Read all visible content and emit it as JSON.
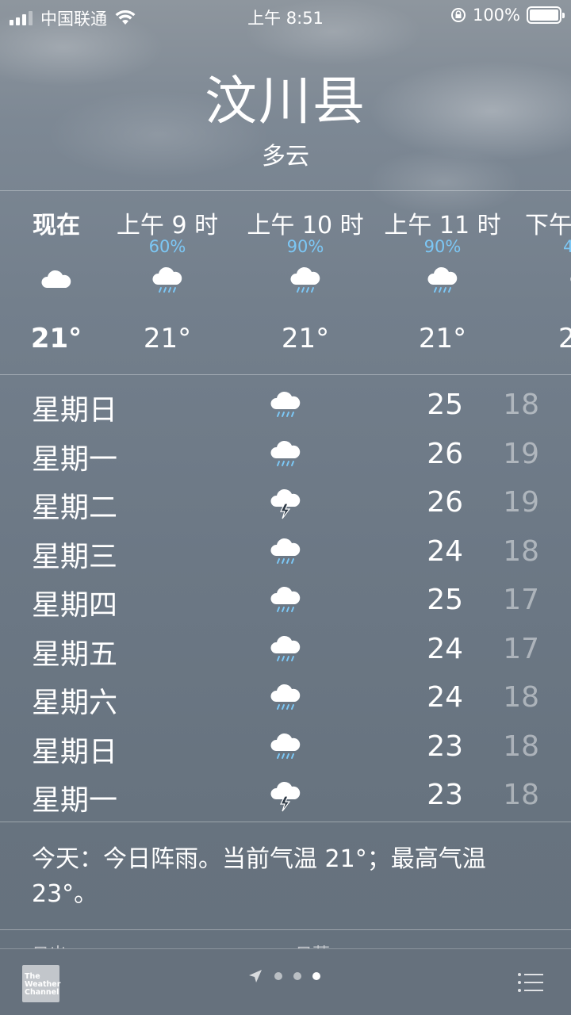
{
  "status_bar": {
    "carrier": "中国联通",
    "time": "上午 8:51",
    "battery": "100%"
  },
  "location": {
    "city": "汶川县",
    "condition": "多云"
  },
  "hourly": [
    {
      "label": "现在",
      "pop": "",
      "icon": "cloud-icon",
      "temp": "21°"
    },
    {
      "label": "上午 9 时",
      "pop": "60%",
      "icon": "rain-cloud-icon",
      "temp": "21°"
    },
    {
      "label": "上午 10 时",
      "pop": "90%",
      "icon": "rain-cloud-icon",
      "temp": "21°"
    },
    {
      "label": "上午 11 时",
      "pop": "90%",
      "icon": "rain-cloud-icon",
      "temp": "21°"
    },
    {
      "label": "下午",
      "pop": "4",
      "icon": "rain-cloud-icon",
      "temp": "2"
    }
  ],
  "daily": [
    {
      "day": "星期日",
      "icon": "rain-cloud-icon",
      "high": "25",
      "low": "18"
    },
    {
      "day": "星期一",
      "icon": "rain-cloud-icon",
      "high": "26",
      "low": "19"
    },
    {
      "day": "星期二",
      "icon": "thunderstorm-icon",
      "high": "26",
      "low": "19"
    },
    {
      "day": "星期三",
      "icon": "rain-cloud-icon",
      "high": "24",
      "low": "18"
    },
    {
      "day": "星期四",
      "icon": "rain-cloud-icon",
      "high": "25",
      "low": "17"
    },
    {
      "day": "星期五",
      "icon": "rain-cloud-icon",
      "high": "24",
      "low": "17"
    },
    {
      "day": "星期六",
      "icon": "rain-cloud-icon",
      "high": "24",
      "low": "18"
    },
    {
      "day": "星期日",
      "icon": "rain-cloud-icon",
      "high": "23",
      "low": "18"
    },
    {
      "day": "星期一",
      "icon": "thunderstorm-icon",
      "high": "23",
      "low": "18"
    }
  ],
  "summary": "今天：今日阵雨。当前气温 21°；最高气温 23°。",
  "details_partial": {
    "left_label": "日出",
    "right_label": "日落"
  },
  "toolbar": {
    "logo_text": [
      "The",
      "Weather",
      "Channel"
    ],
    "pages": 3,
    "active_page": 2
  },
  "colors": {
    "precip_blue": "#7cc7f5",
    "low_temp": "rgba(255,255,255,0.45)"
  }
}
